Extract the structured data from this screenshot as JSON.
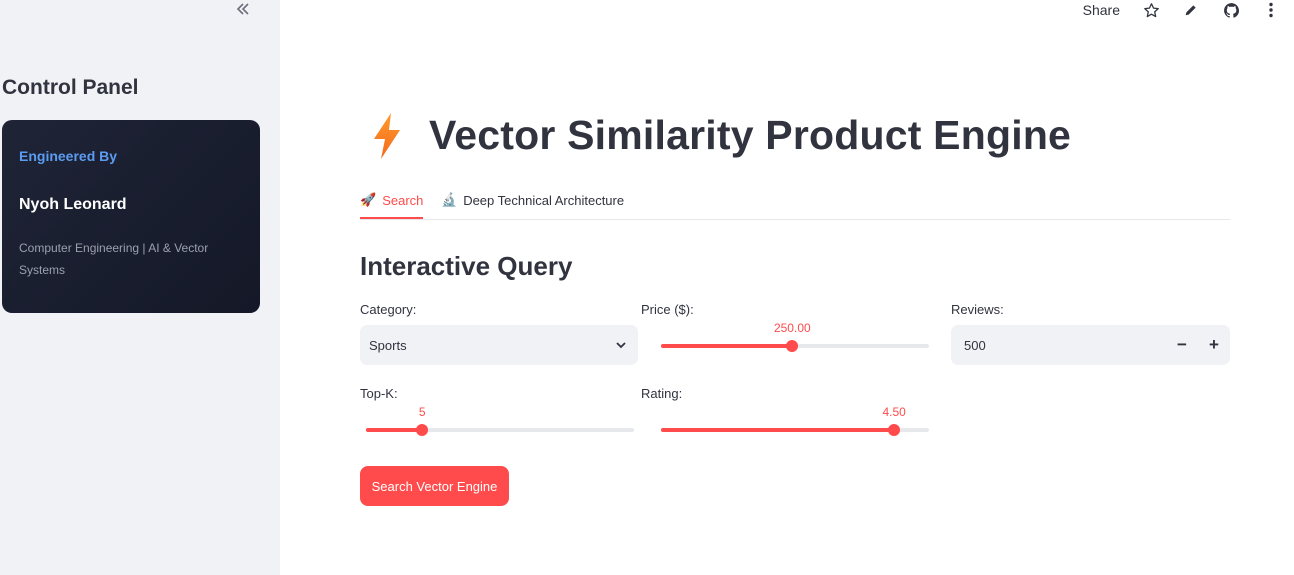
{
  "sidebar": {
    "collapse_icon": "double-chevron-left-icon",
    "title": "Control Panel",
    "card": {
      "engineered_label": "Engineered By",
      "name": "Nyoh Leonard",
      "description": "Computer Engineering | AI & Vector Systems"
    }
  },
  "toolbar": {
    "share_label": "Share",
    "icons": [
      "star-icon",
      "pencil-icon",
      "github-icon",
      "more-vertical-icon"
    ]
  },
  "header": {
    "icon": "lightning-bolt-icon",
    "title": "Vector Similarity Product Engine"
  },
  "tabs": [
    {
      "label": "Search",
      "icon": "🚀",
      "active": true
    },
    {
      "label": "Deep Technical Architecture",
      "icon": "🔬",
      "active": false
    }
  ],
  "section_title": "Interactive Query",
  "controls": {
    "category": {
      "label": "Category:",
      "value": "Sports"
    },
    "price": {
      "label": "Price ($):",
      "value_text": "250.00",
      "fraction": 0.49
    },
    "reviews": {
      "label": "Reviews:",
      "value": "500",
      "minus": "−",
      "plus": "+"
    },
    "topk": {
      "label": "Top-K:",
      "value_text": "5",
      "fraction": 0.21
    },
    "rating": {
      "label": "Rating:",
      "value_text": "4.50",
      "fraction": 0.87
    }
  },
  "search_button": "Search Vector Engine",
  "colors": {
    "accent": "#ff4b4b",
    "sidebar_bg": "#f0f2f6",
    "card_bg": "#1a1f2e",
    "card_highlight": "#5b9cf0",
    "text": "#31333f"
  }
}
